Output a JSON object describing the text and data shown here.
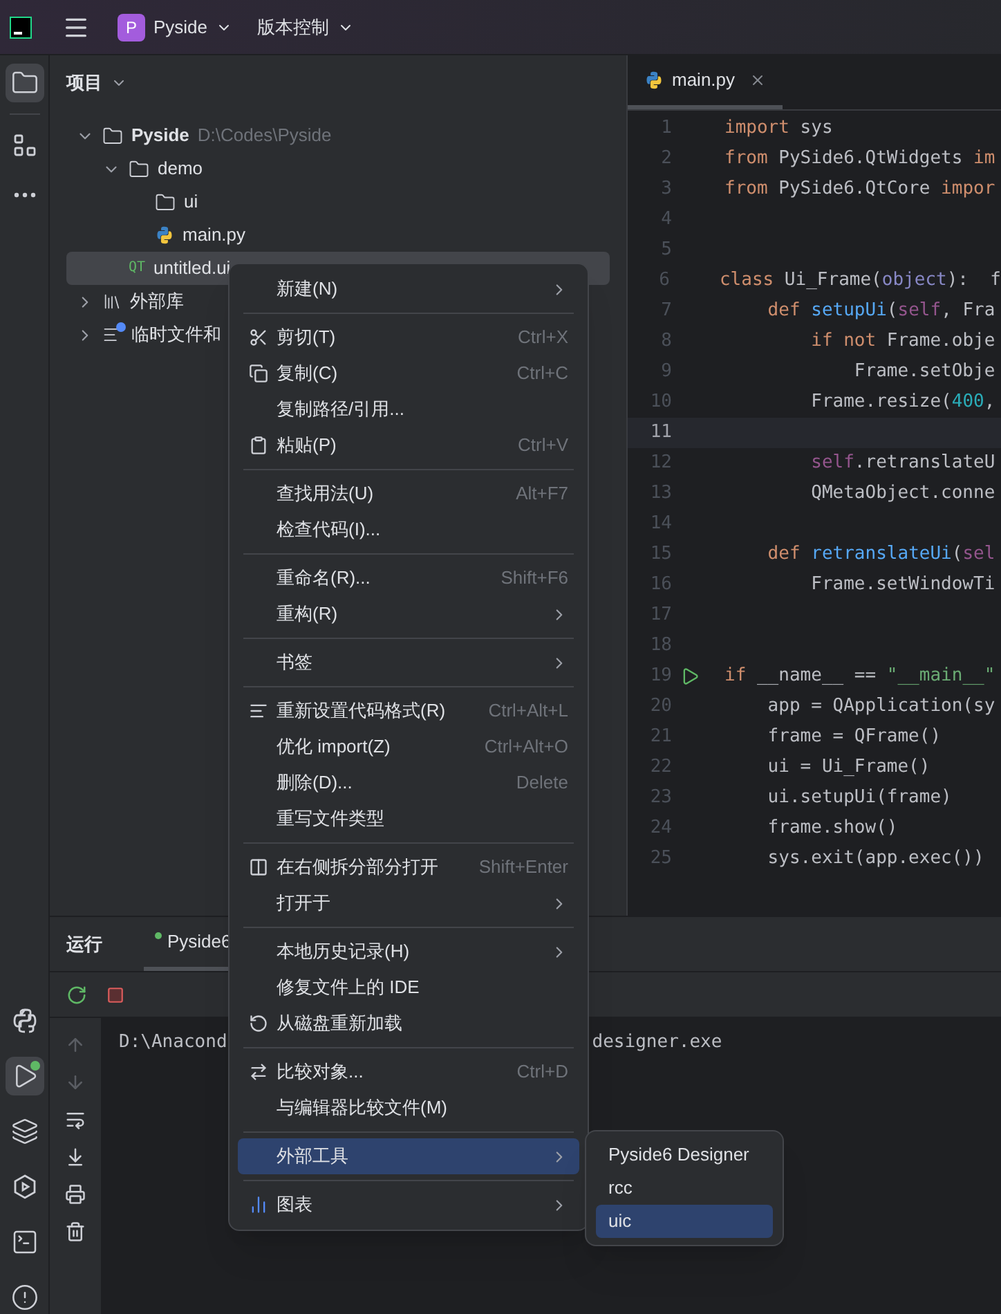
{
  "top_bar": {
    "project_badge": "P",
    "project": "Pyside",
    "vcs": "版本控制"
  },
  "left_toolbar": {
    "top": [
      {
        "kind": "project",
        "selected": true
      },
      {
        "kind": "structure",
        "selected": false
      },
      {
        "kind": "more",
        "selected": false
      }
    ],
    "bottom": [
      {
        "kind": "python",
        "selected": false
      },
      {
        "kind": "run",
        "selected": true,
        "running": true
      },
      {
        "kind": "layers",
        "selected": false
      },
      {
        "kind": "services",
        "selected": false
      },
      {
        "kind": "terminal",
        "selected": false
      },
      {
        "kind": "problems",
        "selected": false
      }
    ]
  },
  "project_panel": {
    "title": "项目",
    "tree": [
      {
        "label": "Pyside",
        "path": "D:\\Codes\\Pyside",
        "kind": "folder",
        "expanded": true,
        "selected": false,
        "children": [
          {
            "label": "demo",
            "kind": "folder",
            "expanded": true,
            "selected": false,
            "children": [
              {
                "label": "ui",
                "kind": "folder",
                "selected": false
              },
              {
                "label": "main.py",
                "kind": "python",
                "selected": false
              }
            ]
          },
          {
            "label": "untitled.ui",
            "kind": "qt",
            "badge": "QT",
            "selected": true
          }
        ]
      },
      {
        "label": "外部库",
        "kind": "library",
        "expanded": false,
        "selected": false
      },
      {
        "label": "临时文件和",
        "kind": "scratch",
        "expanded": false,
        "selected": false
      }
    ]
  },
  "editor": {
    "tabs": [
      {
        "label": "main.py",
        "selected": true
      }
    ],
    "lines": [
      {
        "number": "1",
        "current": false,
        "runnable": false,
        "tokens": [
          {
            "kind": "kw",
            "text": "import"
          },
          {
            "kind": "plain",
            "text": " sys"
          }
        ]
      },
      {
        "number": "2",
        "current": false,
        "runnable": false,
        "tokens": [
          {
            "kind": "kw",
            "text": "from"
          },
          {
            "kind": "plain",
            "text": " PySide6.QtWidgets "
          },
          {
            "kind": "kw",
            "text": "im"
          }
        ]
      },
      {
        "number": "3",
        "current": false,
        "runnable": false,
        "tokens": [
          {
            "kind": "kw",
            "text": "from"
          },
          {
            "kind": "plain",
            "text": " PySide6.QtCore "
          },
          {
            "kind": "kw",
            "text": "impor"
          }
        ]
      },
      {
        "number": "4",
        "current": false,
        "runnable": false
      },
      {
        "number": "5",
        "current": false,
        "runnable": false
      },
      {
        "number": "6",
        "current": false,
        "runnable": false,
        "tokens": [
          {
            "kind": "kw",
            "text": "class"
          },
          {
            "kind": "plain",
            "text": " Ui_Frame("
          },
          {
            "kind": "builtin",
            "text": "object"
          },
          {
            "kind": "plain",
            "text": "):  f"
          }
        ]
      },
      {
        "number": "7",
        "current": false,
        "runnable": false,
        "tokens": [
          {
            "kind": "kw",
            "text": "    def "
          },
          {
            "kind": "fn",
            "text": "setupUi"
          },
          {
            "kind": "plain",
            "text": "("
          },
          {
            "kind": "self",
            "text": "self"
          },
          {
            "kind": "plain",
            "text": ", Fra"
          }
        ]
      },
      {
        "number": "8",
        "current": false,
        "runnable": false,
        "tokens": [
          {
            "kind": "kw",
            "text": "        if not"
          },
          {
            "kind": "plain",
            "text": " Frame.obje"
          }
        ]
      },
      {
        "number": "9",
        "current": false,
        "runnable": false,
        "tokens": [
          {
            "kind": "plain",
            "text": "            Frame.setObje"
          }
        ]
      },
      {
        "number": "10",
        "current": false,
        "runnable": false,
        "tokens": [
          {
            "kind": "plain",
            "text": "        Frame.resize("
          },
          {
            "kind": "num",
            "text": "400"
          },
          {
            "kind": "plain",
            "text": ","
          }
        ]
      },
      {
        "number": "11",
        "current": true,
        "runnable": false
      },
      {
        "number": "12",
        "current": false,
        "runnable": false,
        "tokens": [
          {
            "kind": "self",
            "text": "        self"
          },
          {
            "kind": "plain",
            "text": ".retranslateU"
          }
        ]
      },
      {
        "number": "13",
        "current": false,
        "runnable": false,
        "tokens": [
          {
            "kind": "plain",
            "text": "        QMetaObject.conne"
          }
        ]
      },
      {
        "number": "14",
        "current": false,
        "runnable": false
      },
      {
        "number": "15",
        "current": false,
        "runnable": false,
        "tokens": [
          {
            "kind": "kw",
            "text": "    def "
          },
          {
            "kind": "fn",
            "text": "retranslateUi"
          },
          {
            "kind": "plain",
            "text": "("
          },
          {
            "kind": "self",
            "text": "sel"
          }
        ]
      },
      {
        "number": "16",
        "current": false,
        "runnable": false,
        "tokens": [
          {
            "kind": "plain",
            "text": "        Frame.setWindowTi"
          }
        ]
      },
      {
        "number": "17",
        "current": false,
        "runnable": false
      },
      {
        "number": "18",
        "current": false,
        "runnable": false
      },
      {
        "number": "19",
        "current": false,
        "runnable": true,
        "tokens": [
          {
            "kind": "kw",
            "text": "if"
          },
          {
            "kind": "plain",
            "text": " __name__ == "
          },
          {
            "kind": "str",
            "text": "\"__main__\""
          }
        ]
      },
      {
        "number": "20",
        "current": false,
        "runnable": false,
        "tokens": [
          {
            "kind": "plain",
            "text": "    app = QApplication(sy"
          }
        ]
      },
      {
        "number": "21",
        "current": false,
        "runnable": false,
        "tokens": [
          {
            "kind": "plain",
            "text": "    frame = QFrame()"
          }
        ]
      },
      {
        "number": "22",
        "current": false,
        "runnable": false,
        "tokens": [
          {
            "kind": "plain",
            "text": "    ui = Ui_Frame()"
          }
        ]
      },
      {
        "number": "23",
        "current": false,
        "runnable": false,
        "tokens": [
          {
            "kind": "plain",
            "text": "    ui.setupUi(frame)"
          }
        ]
      },
      {
        "number": "24",
        "current": false,
        "runnable": false,
        "tokens": [
          {
            "kind": "plain",
            "text": "    frame.show()"
          }
        ]
      },
      {
        "number": "25",
        "current": false,
        "runnable": false,
        "tokens": [
          {
            "kind": "plain",
            "text": "    sys.exit(app.exec())"
          }
        ]
      }
    ]
  },
  "run_panel": {
    "title": "运行",
    "tabs": [
      {
        "label": "Pyside6",
        "selected": true,
        "running": true
      }
    ],
    "console_start": "D:\\Anacond",
    "console_end": "designer.exe"
  },
  "context_menu": {
    "items": [
      {
        "kind": "plain",
        "label": "新建(N)",
        "submenu": true,
        "selected": false
      },
      {
        "kind": "separator"
      },
      {
        "kind": "cut",
        "label": "剪切(T)",
        "shortcut": "Ctrl+X",
        "submenu": false,
        "selected": false
      },
      {
        "kind": "copy",
        "label": "复制(C)",
        "shortcut": "Ctrl+C",
        "submenu": false,
        "selected": false
      },
      {
        "kind": "plain",
        "label": "复制路径/引用...",
        "submenu": false,
        "selected": false
      },
      {
        "kind": "paste",
        "label": "粘贴(P)",
        "shortcut": "Ctrl+V",
        "submenu": false,
        "selected": false
      },
      {
        "kind": "separator"
      },
      {
        "kind": "plain",
        "label": "查找用法(U)",
        "shortcut": "Alt+F7",
        "submenu": false,
        "selected": false
      },
      {
        "kind": "plain",
        "label": "检查代码(I)...",
        "submenu": false,
        "selected": false
      },
      {
        "kind": "separator"
      },
      {
        "kind": "plain",
        "label": "重命名(R)...",
        "shortcut": "Shift+F6",
        "submenu": false,
        "selected": false
      },
      {
        "kind": "plain",
        "label": "重构(R)",
        "submenu": true,
        "selected": false
      },
      {
        "kind": "separator"
      },
      {
        "kind": "plain",
        "label": "书签",
        "submenu": true,
        "selected": false
      },
      {
        "kind": "separator"
      },
      {
        "kind": "reformat",
        "label": "重新设置代码格式(R)",
        "shortcut": "Ctrl+Alt+L",
        "submenu": false,
        "selected": false
      },
      {
        "kind": "plain",
        "label": "优化 import(Z)",
        "shortcut": "Ctrl+Alt+O",
        "submenu": false,
        "selected": false
      },
      {
        "kind": "plain",
        "label": "删除(D)...",
        "shortcut": "Delete",
        "submenu": false,
        "selected": false
      },
      {
        "kind": "plain",
        "label": "重写文件类型",
        "submenu": false,
        "selected": false
      },
      {
        "kind": "separator"
      },
      {
        "kind": "split",
        "label": "在右侧拆分部分打开",
        "shortcut": "Shift+Enter",
        "submenu": false,
        "selected": false
      },
      {
        "kind": "plain",
        "label": "打开于",
        "submenu": true,
        "selected": false
      },
      {
        "kind": "separator"
      },
      {
        "kind": "plain",
        "label": "本地历史记录(H)",
        "submenu": true,
        "selected": false
      },
      {
        "kind": "plain",
        "label": "修复文件上的 IDE",
        "submenu": false,
        "selected": false
      },
      {
        "kind": "reload",
        "label": "从磁盘重新加载",
        "submenu": false,
        "selected": false
      },
      {
        "kind": "separator"
      },
      {
        "kind": "compare",
        "label": "比较对象...",
        "shortcut": "Ctrl+D",
        "submenu": false,
        "selected": false
      },
      {
        "kind": "plain",
        "label": "与编辑器比较文件(M)",
        "submenu": false,
        "selected": false
      },
      {
        "kind": "separator"
      },
      {
        "kind": "plain",
        "label": "外部工具",
        "submenu": true,
        "selected": true
      },
      {
        "kind": "separator"
      },
      {
        "kind": "diagram",
        "label": "图表",
        "submenu": true,
        "selected": false
      }
    ]
  },
  "submenu": {
    "items": [
      {
        "label": "Pyside6 Designer",
        "selected": false
      },
      {
        "label": "rcc",
        "selected": false
      },
      {
        "label": "uic",
        "selected": true
      }
    ]
  }
}
